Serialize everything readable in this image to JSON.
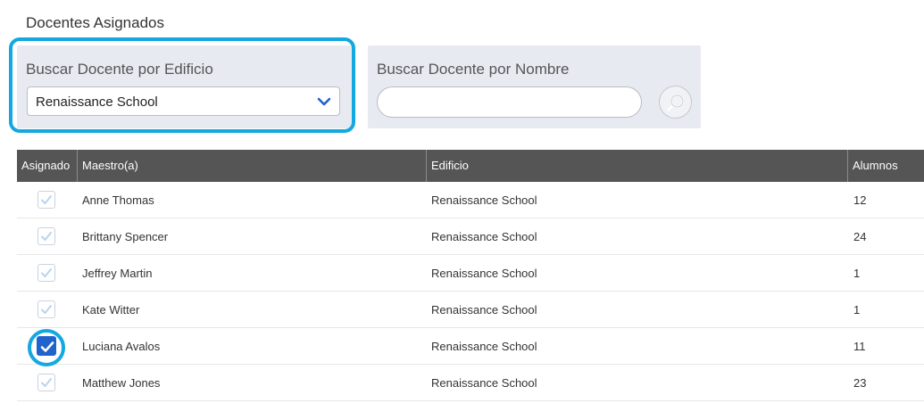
{
  "section": {
    "title": "Docentes Asignados"
  },
  "filters": {
    "building": {
      "label": "Buscar Docente por Edificio",
      "selected": "Renaissance School"
    },
    "name": {
      "label": "Buscar Docente por Nombre",
      "value": "",
      "placeholder": ""
    }
  },
  "table": {
    "headers": [
      "Asignado",
      "Maestro(a)",
      "Edificio",
      "Alumnos"
    ],
    "rows": [
      {
        "assigned": true,
        "highlighted": false,
        "teacher": "Anne Thomas",
        "building": "Renaissance School",
        "students": "12"
      },
      {
        "assigned": true,
        "highlighted": false,
        "teacher": "Brittany Spencer",
        "building": "Renaissance School",
        "students": "24"
      },
      {
        "assigned": true,
        "highlighted": false,
        "teacher": "Jeffrey Martin",
        "building": "Renaissance School",
        "students": "1"
      },
      {
        "assigned": true,
        "highlighted": false,
        "teacher": "Kate Witter",
        "building": "Renaissance School",
        "students": "1"
      },
      {
        "assigned": true,
        "highlighted": true,
        "teacher": "Luciana Avalos",
        "building": "Renaissance School",
        "students": "11"
      },
      {
        "assigned": true,
        "highlighted": false,
        "teacher": "Matthew Jones",
        "building": "Renaissance School",
        "students": "23"
      }
    ]
  },
  "colors": {
    "accent_ring": "#14a8e0",
    "checkbox_active": "#1f63cc",
    "checkbox_inactive_check": "#b9d3ee",
    "header_bg": "#555555",
    "filter_bg": "#e8eaf2"
  },
  "icons": {
    "select_arrow": "chevron-down-icon",
    "search": "magnifier-icon",
    "check": "checkmark-icon"
  }
}
